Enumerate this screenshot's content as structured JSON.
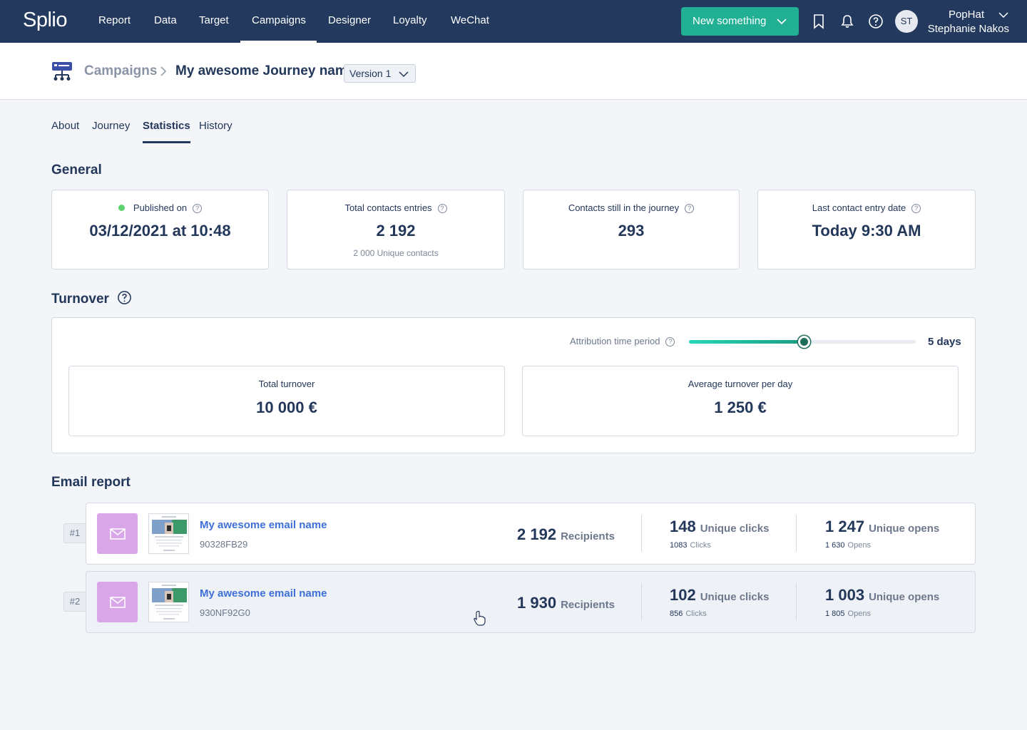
{
  "app": {
    "logo": "Splio"
  },
  "nav": {
    "items": [
      {
        "label": "Report"
      },
      {
        "label": "Data"
      },
      {
        "label": "Target"
      },
      {
        "label": "Campaigns"
      },
      {
        "label": "Designer"
      },
      {
        "label": "Loyalty"
      },
      {
        "label": "WeChat"
      }
    ],
    "active": "Campaigns",
    "new_button": "New something",
    "avatar_initials": "ST",
    "org_name": "PopHat",
    "user_name": "Stephanie Nakos"
  },
  "header": {
    "breadcrumb_root": "Campaigns",
    "journey_title": "My awesome Journey name",
    "version": "Version 1"
  },
  "tabs": [
    {
      "label": "About"
    },
    {
      "label": "Journey"
    },
    {
      "label": "Statistics"
    },
    {
      "label": "History"
    }
  ],
  "active_tab": "Statistics",
  "general": {
    "title": "General",
    "cards": [
      {
        "label": "Published on",
        "value": "03/12/2021 at 10:48",
        "sub": "",
        "status_color": "#5dd16f"
      },
      {
        "label": "Total contacts entries",
        "value": "2 192",
        "sub": "2 000 Unique contacts"
      },
      {
        "label": "Contacts still in the journey",
        "value": "293",
        "sub": ""
      },
      {
        "label": "Last contact entry date",
        "value": "Today 9:30 AM",
        "sub": ""
      }
    ]
  },
  "turnover": {
    "title": "Turnover",
    "attribution_label": "Attribution time period",
    "attribution_value": "5 days",
    "slider_level": 0.505,
    "total_label": "Total turnover",
    "total_value": "10 000 €",
    "avg_label": "Average turnover per day",
    "avg_value": "1 250 €"
  },
  "email_report": {
    "title": "Email report",
    "rows": [
      {
        "rank": "#1",
        "name": "My awesome email name",
        "id": "90328FB29",
        "recipients": "2 192",
        "recipients_label": "Recipients",
        "unique_clicks": "148",
        "unique_clicks_label": "Unique clicks",
        "clicks": "1083",
        "clicks_label": "Clicks",
        "unique_opens": "1 247",
        "unique_opens_label": "Unique opens",
        "opens": "1 630",
        "opens_label": "Opens"
      },
      {
        "rank": "#2",
        "name": "My awesome email name",
        "id": "930NF92G0",
        "recipients": "1 930",
        "recipients_label": "Recipients",
        "unique_clicks": "102",
        "unique_clicks_label": "Unique clicks",
        "clicks": "856",
        "clicks_label": "Clicks",
        "unique_opens": "1 003",
        "unique_opens_label": "Unique opens",
        "opens": "1 805",
        "opens_label": "Opens"
      }
    ]
  },
  "colors": {
    "nav_bg": "#233a5e",
    "accent_green": "#21b094",
    "link_blue": "#3f6fd8",
    "mail_tile": "#d9a7e8"
  },
  "icons": [
    "bookmark-icon",
    "bell-icon",
    "help-icon",
    "chevron-down-icon",
    "journey-icon",
    "chevron-right-icon",
    "mail-icon",
    "pointer-cursor-icon"
  ]
}
